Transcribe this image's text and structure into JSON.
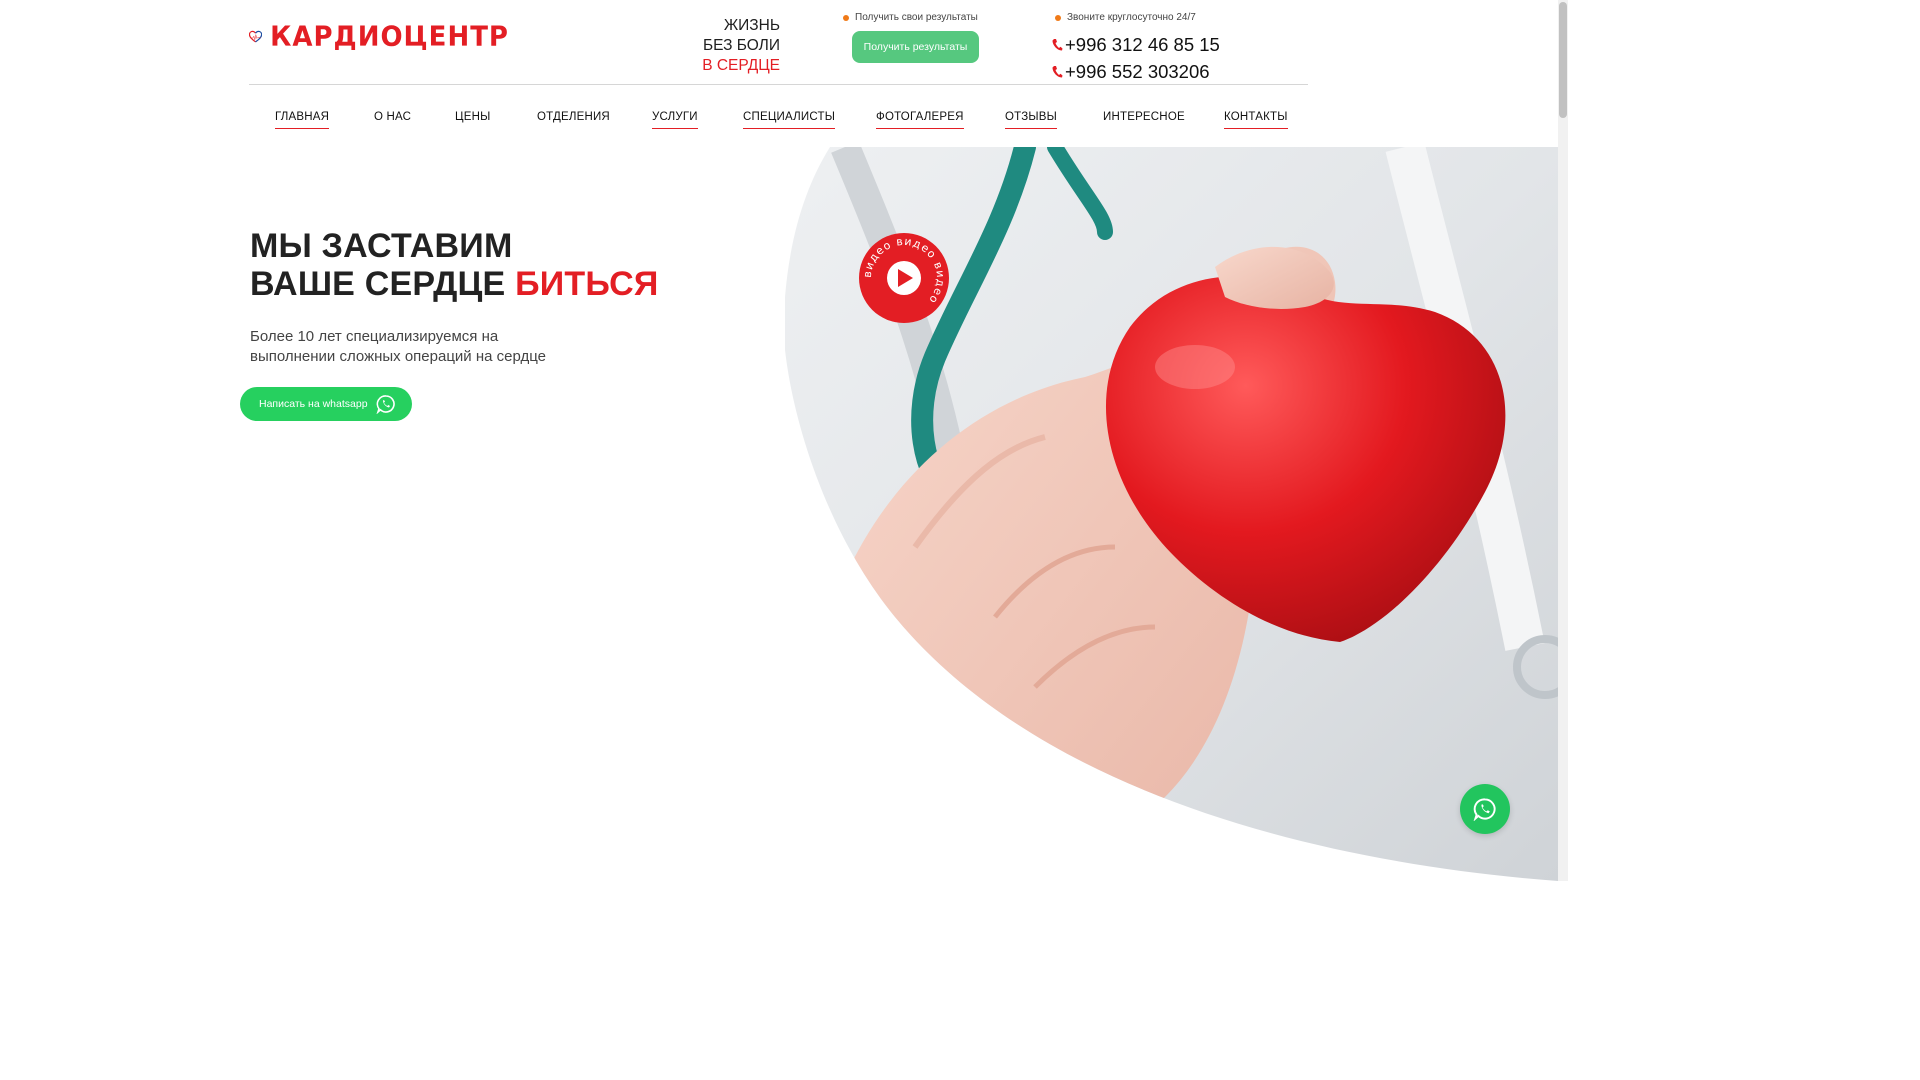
{
  "brand": {
    "name": "КАРДИОЦЕНТР"
  },
  "slogan": {
    "line1": "ЖИЗНЬ",
    "line2": "БЕЗ БОЛИ",
    "line3": "В СЕРДЦЕ"
  },
  "results": {
    "note": "Получить свои результаты",
    "button_label": "Получить результаты"
  },
  "contacts": {
    "note": "Звоните круглосуточно 24/7",
    "phone1": "+996 312 46 85 15",
    "phone2": "+996 552 303206"
  },
  "nav": {
    "items": [
      {
        "label": "ГЛАВНАЯ",
        "underlined": true
      },
      {
        "label": "О НАС",
        "underlined": false
      },
      {
        "label": "ЦЕНЫ",
        "underlined": false
      },
      {
        "label": "ОТДЕЛЕНИЯ",
        "underlined": false
      },
      {
        "label": "УСЛУГИ",
        "underlined": true
      },
      {
        "label": "СПЕЦИАЛИСТЫ",
        "underlined": true
      },
      {
        "label": "ФОТОГАЛЕРЕЯ",
        "underlined": true
      },
      {
        "label": "ОТЗЫВЫ",
        "underlined": true
      },
      {
        "label": "ИНТЕРЕСНОЕ",
        "underlined": false
      },
      {
        "label": "КОНТАКТЫ",
        "underlined": true
      }
    ]
  },
  "hero": {
    "title_line1": "МЫ ЗАСТАВИМ",
    "title_line2": "ВАШЕ СЕРДЦЕ",
    "title_accent": "БИТЬСЯ",
    "description_line1": "Более 10 лет специализируемся на",
    "description_line2": "выполнении сложных операций на сердце",
    "whatsapp_button": "Написать на whatsapp",
    "video_badge": "видео видео видео"
  },
  "colors": {
    "accent": "#e31e24",
    "green_button": "#56c87f",
    "whatsapp": "#26d05f",
    "dot": "#f07a18"
  },
  "icons": [
    "logo-heart-icon",
    "phone-icon",
    "whatsapp-icon",
    "play-icon"
  ]
}
